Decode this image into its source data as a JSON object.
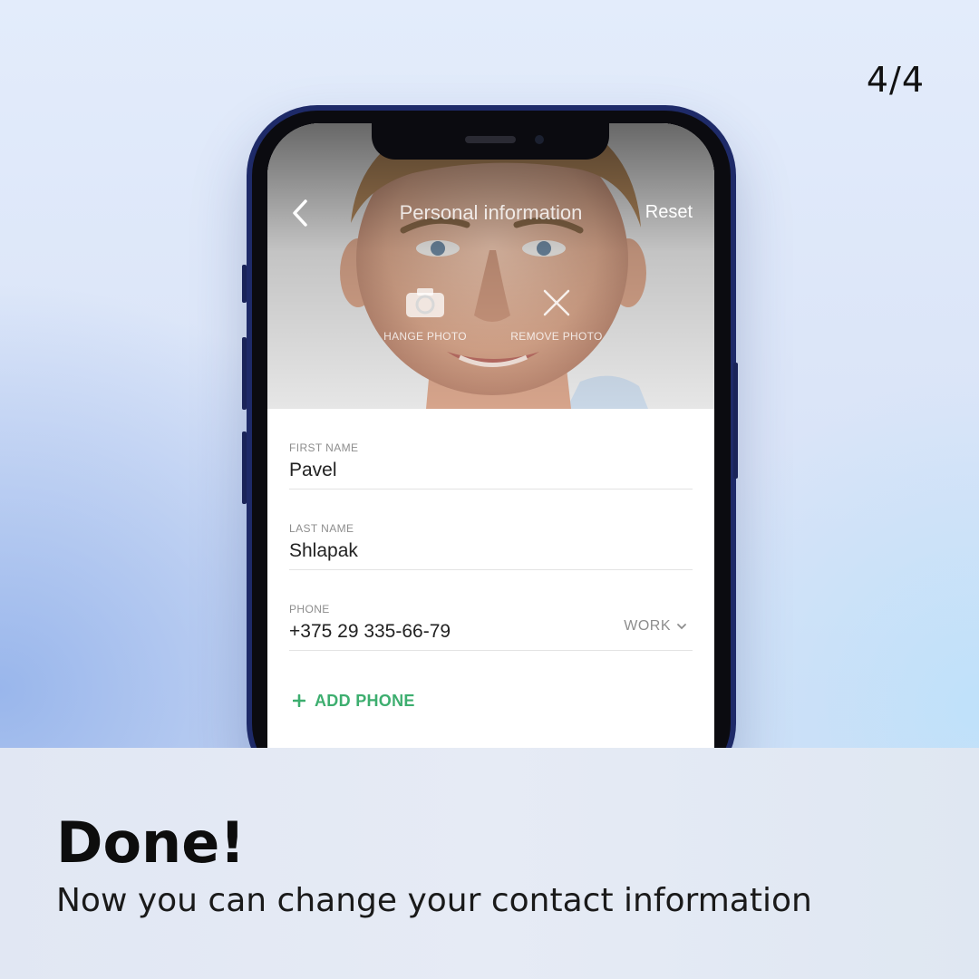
{
  "progress": {
    "counter": "4/4"
  },
  "screen": {
    "header": {
      "title": "Personal information",
      "reset_label": "Reset",
      "back_icon": "chevron-left-icon"
    },
    "photo_actions": {
      "change_label": "HANGE PHOTO",
      "change_icon": "camera-icon",
      "remove_label": "REMOVE PHOTO",
      "remove_icon": "close-icon"
    },
    "fields": {
      "first_name": {
        "label": "FIRST NAME",
        "value": "Pavel"
      },
      "last_name": {
        "label": "LAST NAME",
        "value": "Shlapak"
      },
      "phone": {
        "label": "PHONE",
        "value": "+375 29 335-66-79",
        "type": "WORK"
      }
    },
    "add_phone_label": "ADD PHONE"
  },
  "caption": {
    "title": "Done!",
    "subtitle": "Now you can change your contact information"
  },
  "colors": {
    "accent_green": "#3dae6f",
    "phone_frame": "#1e2a68"
  }
}
